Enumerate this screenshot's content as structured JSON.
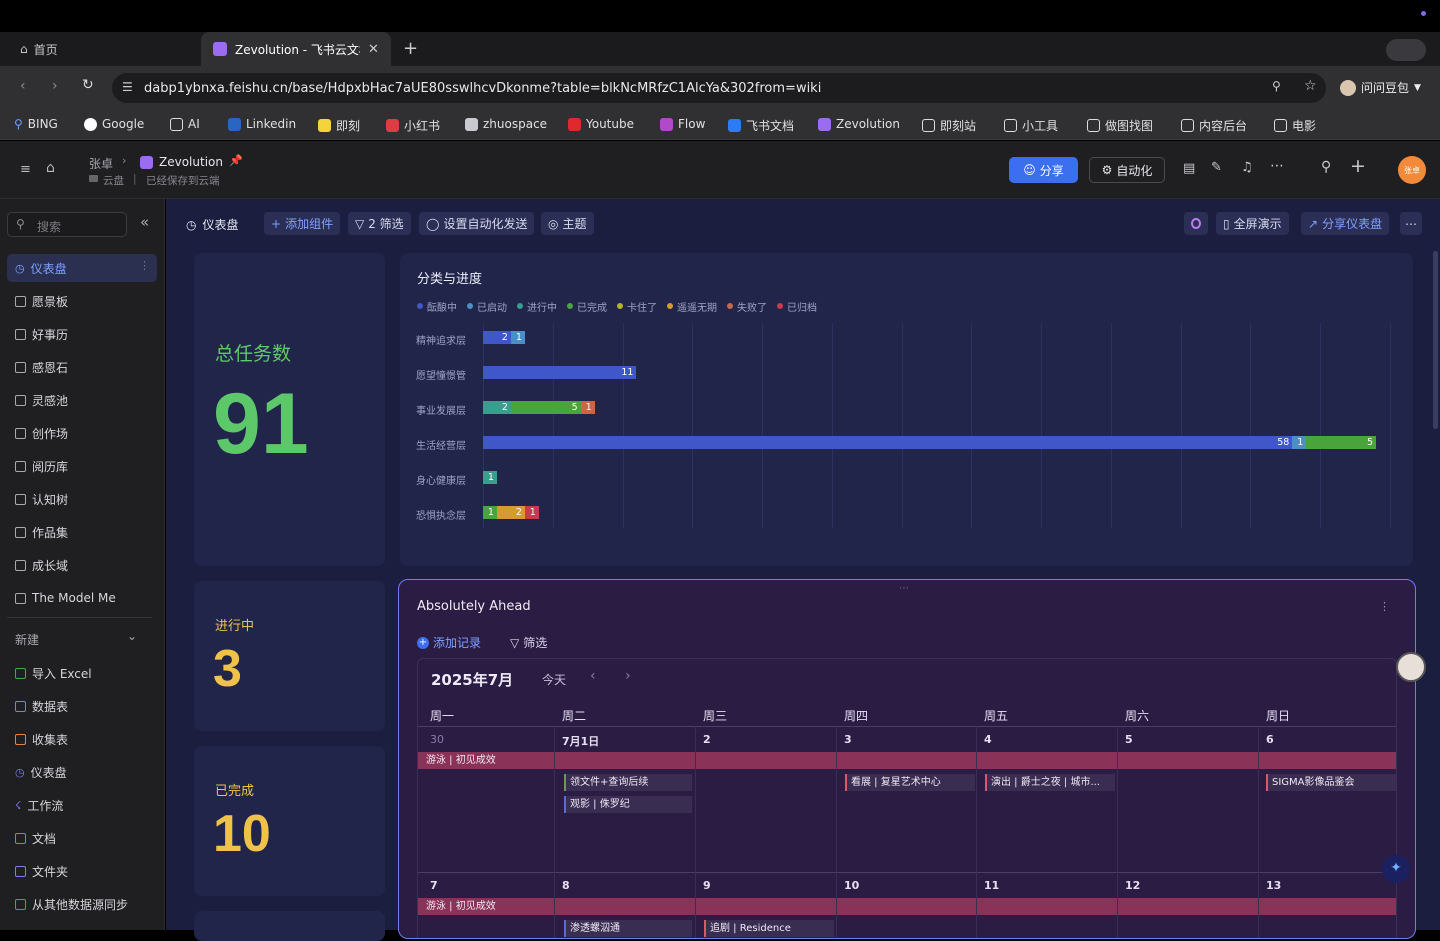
{
  "browser": {
    "tabs": [
      {
        "label": "首页"
      },
      {
        "label": "Zevolution - 飞书云文档"
      }
    ],
    "url": "dabp1ybnxa.feishu.cn/base/HdpxbHac7aUE80sswlhcvDkonme?table=blkNcMRfzC1AlcYa&302from=wiki",
    "profile_name": "问问豆包",
    "bookmarks": [
      "BING",
      "Google",
      "AI",
      "Linkedin",
      "即刻",
      "小红书",
      "zhuospace",
      "Youtube",
      "Flow",
      "飞书文档",
      "Zevolution",
      "即刻站",
      "小工具",
      "做图找图",
      "内容后台",
      "电影"
    ]
  },
  "header": {
    "breadcrumb_user": "张卓",
    "doc_name": "Zevolution",
    "location": "云盘",
    "save_status": "已经保存到云端",
    "share_label": "分享",
    "automation_label": "自动化",
    "avatar_text": "张卓"
  },
  "sidebar": {
    "search_placeholder": "搜索",
    "items": [
      {
        "label": "仪表盘"
      },
      {
        "label": "愿景板"
      },
      {
        "label": "好事历"
      },
      {
        "label": "感恩石"
      },
      {
        "label": "灵感池"
      },
      {
        "label": "创作场"
      },
      {
        "label": "阅历库"
      },
      {
        "label": "认知树"
      },
      {
        "label": "作品集"
      },
      {
        "label": "成长域"
      },
      {
        "label": "The Model Me"
      }
    ],
    "new_label": "新建",
    "new_items": [
      {
        "label": "导入 Excel"
      },
      {
        "label": "数据表"
      },
      {
        "label": "收集表"
      },
      {
        "label": "仪表盘"
      },
      {
        "label": "工作流"
      },
      {
        "label": "文档"
      },
      {
        "label": "文件夹"
      },
      {
        "label": "从其他数据源同步"
      }
    ]
  },
  "toolbar": {
    "title": "仪表盘",
    "add_widget": "添加组件",
    "filter": "2 筛选",
    "auto_send": "设置自动化发送",
    "theme": "主题",
    "fullscreen": "全屏演示",
    "share_dashboard": "分享仪表盘"
  },
  "kpis": [
    {
      "title": "总任务数",
      "value": "91",
      "color": "#5dc86a"
    },
    {
      "title": "进行中",
      "value": "3",
      "color": "#f0c24a"
    },
    {
      "title": "已完成",
      "value": "10",
      "color": "#f0c24a"
    }
  ],
  "chart_data": {
    "type": "bar",
    "orientation": "horizontal-stacked",
    "title": "分类与进度",
    "xlim": [
      0,
      65
    ],
    "xticks": [
      0,
      5,
      10,
      15,
      20,
      25,
      30,
      35,
      40,
      45,
      50,
      55,
      60,
      65
    ],
    "grid": true,
    "legend_position": "top-left",
    "categories": [
      "精神追求层",
      "愿望憧憬管",
      "事业发展层",
      "生活经营层",
      "身心健康层",
      "恐惧执念层"
    ],
    "series": [
      {
        "name": "酝酿中",
        "color": "#3f57c9",
        "values": [
          2,
          11,
          0,
          58,
          0,
          0
        ]
      },
      {
        "name": "已启动",
        "color": "#4a90c8",
        "values": [
          1,
          0,
          0,
          1,
          0,
          0
        ]
      },
      {
        "name": "进行中",
        "color": "#3a9e8e",
        "values": [
          0,
          0,
          2,
          0,
          1,
          0
        ]
      },
      {
        "name": "已完成",
        "color": "#4aa43c",
        "values": [
          0,
          0,
          5,
          5,
          0,
          1
        ]
      },
      {
        "name": "卡住了",
        "color": "#b3b32c",
        "values": [
          0,
          0,
          0,
          0,
          0,
          0
        ]
      },
      {
        "name": "遥遥无期",
        "color": "#d69a30",
        "values": [
          0,
          0,
          0,
          0,
          0,
          2
        ]
      },
      {
        "name": "失败了",
        "color": "#c8664a",
        "values": [
          0,
          0,
          1,
          0,
          0,
          0
        ]
      },
      {
        "name": "已归档",
        "color": "#c83a4e",
        "values": [
          0,
          0,
          0,
          0,
          0,
          1
        ]
      }
    ]
  },
  "calendar": {
    "title": "Absolutely Ahead",
    "add_record": "添加记录",
    "filter": "筛选",
    "month": "2025年7月",
    "today": "今天",
    "weekdays": [
      "周一",
      "周二",
      "周三",
      "周四",
      "周五",
      "周六",
      "周日"
    ],
    "week1": [
      "30",
      "7月1日",
      "2",
      "3",
      "4",
      "5",
      "6"
    ],
    "week2": [
      "7",
      "8",
      "9",
      "10",
      "11",
      "12",
      "13"
    ],
    "span_event": "游泳 | 初见成效",
    "events": [
      {
        "label": "领文件+查询后续",
        "color": "#6a9a4a"
      },
      {
        "label": "观影 | 侏罗纪",
        "color": "#5a6ad8"
      },
      {
        "label": "看展 | 复星艺术中心",
        "color": "#d85a6a"
      },
      {
        "label": "演出 | 爵士之夜 | 城市...",
        "color": "#d85a6a"
      },
      {
        "label": "SIGMA影像品鉴会",
        "color": "#d85a6a"
      }
    ],
    "week2_events": [
      {
        "label": "渗透螺泅通",
        "color": "#5a6ad8"
      },
      {
        "label": "追剧 | Residence",
        "color": "#d85a6a"
      }
    ]
  }
}
